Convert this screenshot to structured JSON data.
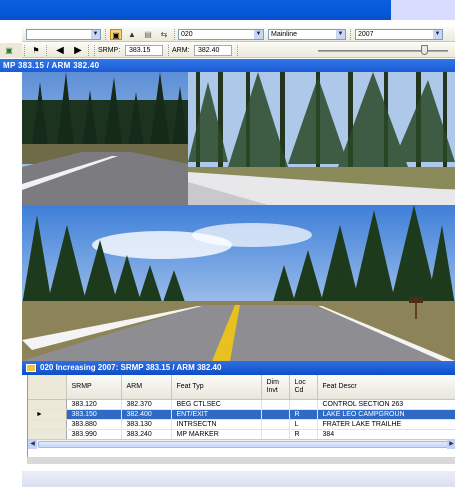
{
  "toolbar1": {
    "route_value": "020",
    "roadbed_value": "Mainline",
    "year_value": "2007"
  },
  "toolbar2": {
    "srmp_label": "SRMP:",
    "srmp_value": "383.15",
    "arm_label": "ARM:",
    "arm_value": "382.40"
  },
  "viewer": {
    "title": "MP 383.15 / ARM 382.40"
  },
  "grid": {
    "title": "020 Increasing 2007: SRMP 383.15 / ARM 382.40",
    "columns": [
      "SRMP",
      "ARM",
      "Feat Typ",
      "Dim Invt",
      "Loc Cd",
      "Feat Descr"
    ],
    "rows": [
      {
        "srmp": "383.120",
        "arm": "382.370",
        "feat_typ": "BEG CTLSEC",
        "dim_invt": "",
        "loc_cd": "",
        "feat_descr": "CONTROL SECTION 263",
        "selected": false,
        "marker": ""
      },
      {
        "srmp": "383.150",
        "arm": "382.400",
        "feat_typ": "ENT/EXIT",
        "dim_invt": "",
        "loc_cd": "R",
        "feat_descr": "LAKE LEO CAMPGROUN",
        "selected": true,
        "marker": "►"
      },
      {
        "srmp": "383.880",
        "arm": "383.130",
        "feat_typ": "INTRSECTN",
        "dim_invt": "",
        "loc_cd": "L",
        "feat_descr": "FRATER LAKE TRAILHE",
        "selected": false,
        "marker": ""
      },
      {
        "srmp": "383.990",
        "arm": "383.240",
        "feat_typ": "MP MARKER",
        "dim_invt": "",
        "loc_cd": "R",
        "feat_descr": "384",
        "selected": false,
        "marker": ""
      }
    ]
  },
  "colors": {
    "titlebar": "#0658d8",
    "selection": "#316ac5",
    "sky": "#7fb0ea",
    "forest": "#1f3a1f"
  }
}
